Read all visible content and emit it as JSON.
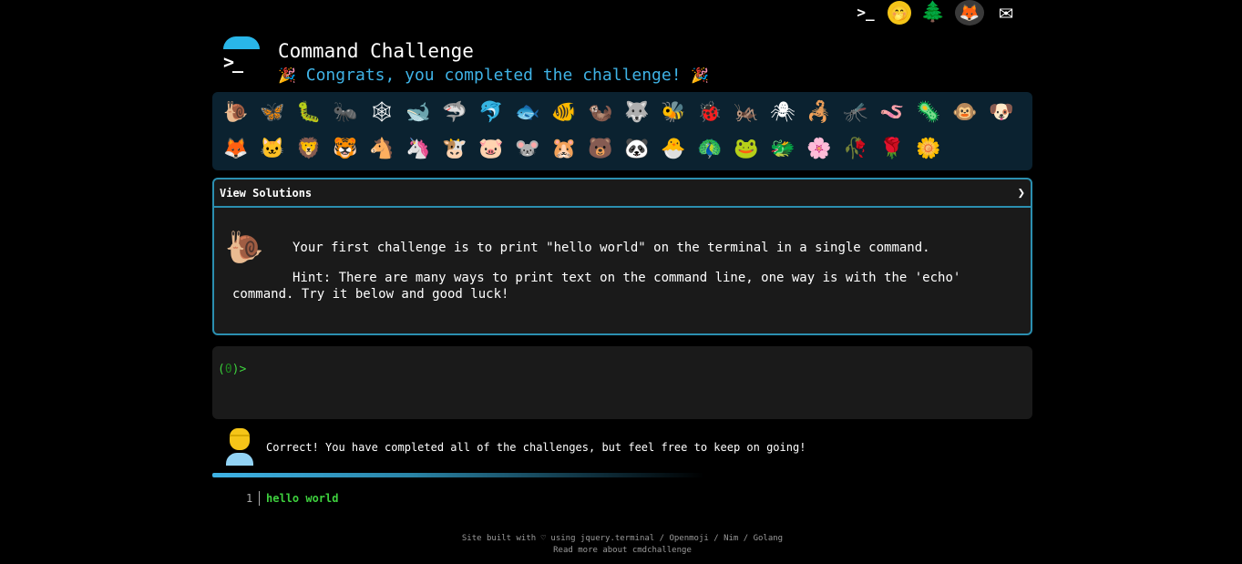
{
  "top_icons": [
    {
      "name": "terminal-icon",
      "glyph": ">_"
    },
    {
      "name": "face-hand-over-mouth-icon",
      "glyph": "🤭"
    },
    {
      "name": "tree-icon",
      "glyph": "🌲"
    },
    {
      "name": "gitlab-icon",
      "glyph": "🦊"
    },
    {
      "name": "mail-icon",
      "glyph": "✉"
    }
  ],
  "header": {
    "logo_glyph": ">_",
    "title": "Command Challenge",
    "congrats_party_left": "🎉",
    "congrats_text": " Congrats, you completed the challenge! ",
    "congrats_party_right": "🎉"
  },
  "animals": {
    "row1": [
      "🐌",
      "🦋",
      "🐛",
      "🐜",
      "🕸",
      "🐋",
      "🦈",
      "🐬",
      "🐟",
      "🐠",
      "🦦",
      "🐺",
      "🐝",
      "🐞",
      "🦗",
      "🕷",
      "🦂",
      "🦟",
      "🪱",
      "🦠",
      "🐵",
      "🐶"
    ],
    "row2": [
      "🦊",
      "🐱",
      "🦁",
      "🐯",
      "🐴",
      "🦄",
      "🐮",
      "🐷",
      "🐭",
      "🐹",
      "🐻",
      "🐼",
      "🐣",
      "🦚",
      "🐸",
      "🐲",
      "🌸",
      "🥀",
      "🌹",
      "🌼"
    ]
  },
  "solutions": {
    "label": "View Solutions",
    "chevron": "❯",
    "snail_glyph": "🐌",
    "challenge_text": "Your first challenge is to print \"hello world\" on the terminal in a single command.",
    "hint_text": "Hint: There are many ways to print text on the command line, one way is with the 'echo' command. Try it below and good luck!"
  },
  "terminal": {
    "prompt_open": "(",
    "prompt_count": "0",
    "prompt_close": ")>"
  },
  "result": {
    "message": "Correct! You have completed all of the challenges, but feel free to keep on going!"
  },
  "progress": {
    "fraction": 1.0
  },
  "output": {
    "line_number": "1",
    "line_text": "hello world"
  },
  "footer": {
    "line1": "Site built with ♡ using jquery.terminal / Openmoji / Nim / Golang",
    "line2": "Read more about cmdchallenge"
  },
  "colors": {
    "accent": "#3fb3e6",
    "border": "#2b8fb0",
    "prompt_green": "#3ed13e",
    "panel_bg": "#1a1a1a",
    "animals_bg": "#0b2230"
  }
}
